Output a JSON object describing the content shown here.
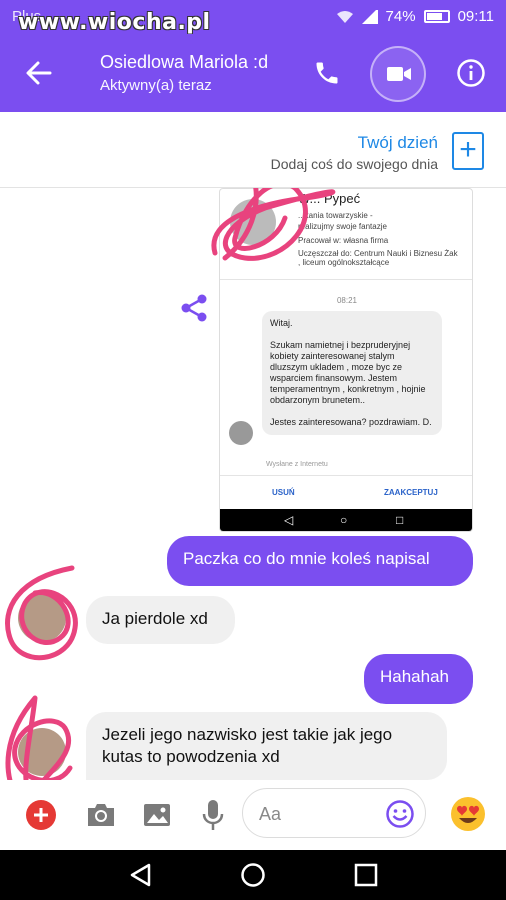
{
  "status_bar": {
    "carrier": "Plus",
    "watermark": "www.wiocha.pl",
    "battery": "74%",
    "time": "09:11"
  },
  "header": {
    "contact_name": "Osiedlowa Mariola :d",
    "presence": "Aktywny(a) teraz"
  },
  "your_day": {
    "title": "Twój dzień",
    "subtitle": "Dodaj coś do swojego dnia",
    "add_label": "+"
  },
  "shared_screenshot": {
    "profile_name": "W... Pypeć",
    "profile_line1": "...kania towarzyskie -",
    "profile_line2": "realizujmy swoje fantazje",
    "work": "Pracował w: własna firma",
    "education": "Uczęszczał do: Centrum Nauki i Biznesu Żak , liceum ogólnokształcące",
    "time": "08:21",
    "message": "Witaj.\n\nSzukam namietnej i bezpruderyjnej kobiety zainteresowanej stalym dluzszym ukladem , moze byc ze wsparciem finansowym. Jestem temperamentnym , konkretnym , hojnie obdarzonym brunetem..\n\nJestes zainteresowana? pozdrawiam. D.",
    "sent_via": "Wysłane z Internetu",
    "delete_label": "USUŃ",
    "accept_label": "ZAAKCEPTUJ"
  },
  "messages": [
    {
      "from": "me",
      "text": "Paczka co do mnie koleś napisal"
    },
    {
      "from": "them",
      "text": "Ja pierdole xd"
    },
    {
      "from": "me",
      "text": "Hahahah"
    },
    {
      "from": "them",
      "text": "Jezeli jego nazwisko jest takie jak jego kutas to powodzenia xd"
    }
  ],
  "composer": {
    "placeholder": "Aa"
  },
  "colors": {
    "accent": "#7b4ef0",
    "link": "#1e88e5",
    "scribble": "#e8437e"
  },
  "icons": [
    "back-arrow-icon",
    "phone-icon",
    "video-call-icon",
    "info-icon",
    "plus-icon",
    "share-icon",
    "camera-icon",
    "image-icon",
    "microphone-icon",
    "emoji-icon",
    "heart-eyes-emoji-icon",
    "android-back-icon",
    "android-home-icon",
    "android-recents-icon"
  ]
}
